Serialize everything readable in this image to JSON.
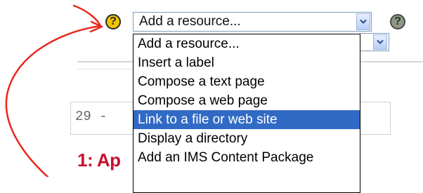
{
  "resource_select": {
    "value": "Add a resource...",
    "options": [
      "Add a resource...",
      "Insert a label",
      "Compose a text page",
      "Compose a web page",
      "Link to a file or web site",
      "Display a directory",
      "Add an IMS Content Package"
    ],
    "highlighted_option": "Link to a file or web site"
  },
  "help_icons": [
    "help-icon",
    "help-icon"
  ],
  "background": {
    "date_fragment": "29 - ",
    "section_title_fragment": "1: Ap"
  },
  "colors": {
    "annotation_arrow": "#e8271d",
    "highlight": "#316ac5",
    "section_title": "#c8102e",
    "help_icon_yellow": "#f2c200"
  }
}
